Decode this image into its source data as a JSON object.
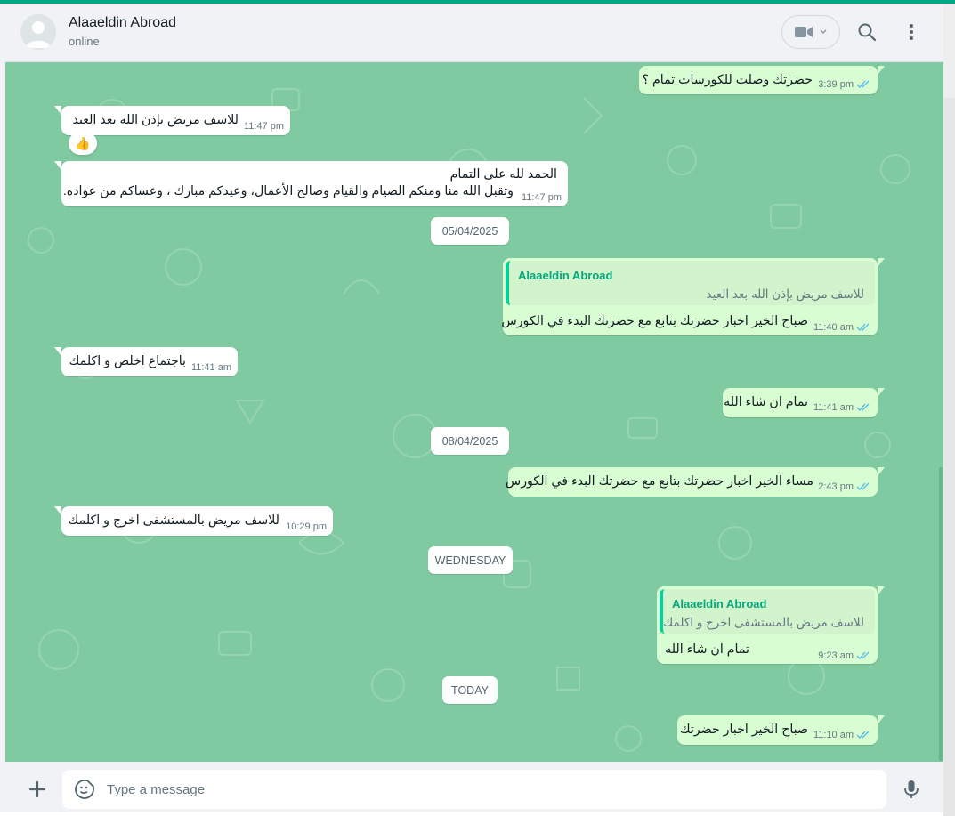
{
  "header": {
    "contact_name": "Alaaeldin Abroad",
    "status": "online"
  },
  "messages": {
    "m1": {
      "text": "حضرتك وصلت للكورسات تمام ؟",
      "time": "3:39 pm"
    },
    "m2": {
      "text": "للاسف مريض بإذن الله بعد العيد",
      "time": "11:47 pm",
      "reaction": "👍"
    },
    "m3": {
      "line1": "الحمد لله على التمام",
      "line2": "وتقبل الله منا ومنكم الصيام والقيام وصالح الأعمال، وعيدكم مبارك ، وعساكم من عواده.",
      "time": "11:47 pm"
    },
    "d1": "05/04/2025",
    "m4": {
      "quote_name": "Alaaeldin Abroad",
      "quote_text": "للاسف مريض بإذن الله بعد العيد",
      "text": "صباح الخير اخبار حضرتك بتابع مع حضرتك البدء في الكورس",
      "time": "11:40 am"
    },
    "m5": {
      "text": "باجتماع اخلص و اكلمك",
      "time": "11:41 am"
    },
    "m6": {
      "text": "تمام ان شاء الله",
      "time": "11:41 am"
    },
    "d2": "08/04/2025",
    "m7": {
      "text": "مساء الخير اخبار حضرتك بتابع مع حضرتك البدء في الكورس",
      "time": "2:43 pm"
    },
    "m8": {
      "text": "للاسف مريض بالمستشفى اخرج و اكلمك",
      "time": "10:29 pm"
    },
    "d3": "WEDNESDAY",
    "m9": {
      "quote_name": "Alaaeldin Abroad",
      "quote_text": "للاسف مريض بالمستشفى اخرج و اكلمك",
      "text": "تمام ان شاء الله",
      "time": "9:23 am"
    },
    "d4": "TODAY",
    "m10": {
      "text": "صباح الخير اخبار حضرتك",
      "time": "11:10 am"
    }
  },
  "composer": {
    "placeholder": "Type a message"
  },
  "icons": {
    "video": "video-call-icon",
    "search": "search-icon",
    "menu": "menu-icon",
    "attach": "plus-icon",
    "emoji": "emoji-icon",
    "mic": "mic-icon",
    "read": "double-check-icon"
  },
  "colors": {
    "accent": "#00a884",
    "chat_bg": "#7fcaa0",
    "outgoing_bubble": "#d9fdd3",
    "incoming_bubble": "#ffffff",
    "read_ticks": "#53bdeb"
  }
}
